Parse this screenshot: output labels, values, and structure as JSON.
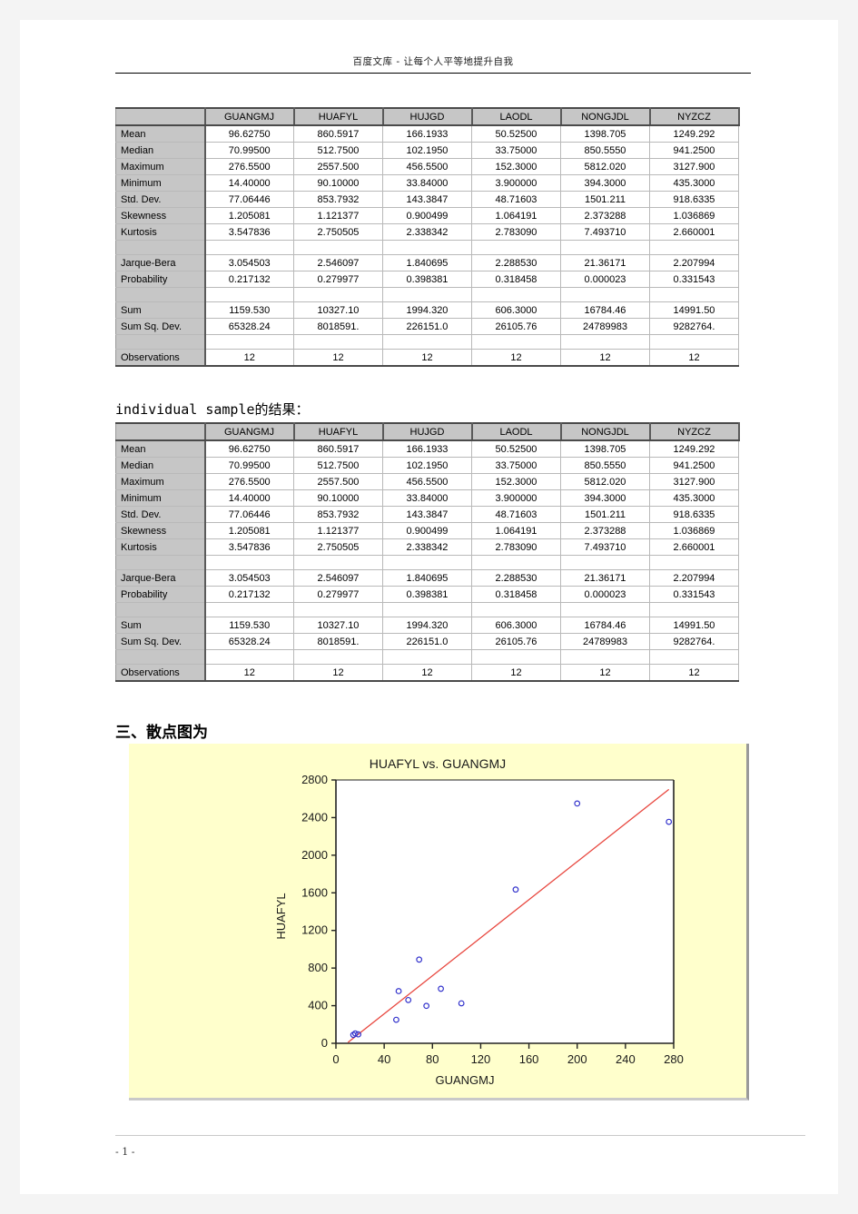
{
  "header": {
    "text": "百度文库 - 让每个人平等地提升自我"
  },
  "footer": {
    "page_number": "- 1 -"
  },
  "body": {
    "mid_note_mono": "individual sample",
    "mid_note_cn": "的结果：",
    "section_heading": "三、散点图为"
  },
  "table": {
    "corner_label": "",
    "columns": [
      "GUANGMJ",
      "HUAFYL",
      "HUJGD",
      "LAODL",
      "NONGJDL",
      "NYZCZ"
    ],
    "rows": [
      {
        "label": "Mean",
        "values": [
          "96.62750",
          "860.5917",
          "166.1933",
          "50.52500",
          "1398.705",
          "1249.292"
        ]
      },
      {
        "label": "Median",
        "values": [
          "70.99500",
          "512.7500",
          "102.1950",
          "33.75000",
          "850.5550",
          "941.2500"
        ]
      },
      {
        "label": "Maximum",
        "values": [
          "276.5500",
          "2557.500",
          "456.5500",
          "152.3000",
          "5812.020",
          "3127.900"
        ]
      },
      {
        "label": "Minimum",
        "values": [
          "14.40000",
          "90.10000",
          "33.84000",
          "3.900000",
          "394.3000",
          "435.3000"
        ]
      },
      {
        "label": "Std. Dev.",
        "values": [
          "77.06446",
          "853.7932",
          "143.3847",
          "48.71603",
          "1501.211",
          "918.6335"
        ]
      },
      {
        "label": "Skewness",
        "values": [
          "1.205081",
          "1.121377",
          "0.900499",
          "1.064191",
          "2.373288",
          "1.036869"
        ]
      },
      {
        "label": "Kurtosis",
        "values": [
          "3.547836",
          "2.750505",
          "2.338342",
          "2.783090",
          "7.493710",
          "2.660001"
        ]
      },
      {
        "label": "",
        "values": [
          "",
          "",
          "",
          "",
          "",
          ""
        ],
        "gap": true
      },
      {
        "label": "Jarque-Bera",
        "values": [
          "3.054503",
          "2.546097",
          "1.840695",
          "2.288530",
          "21.36171",
          "2.207994"
        ]
      },
      {
        "label": "Probability",
        "values": [
          "0.217132",
          "0.279977",
          "0.398381",
          "0.318458",
          "0.000023",
          "0.331543"
        ]
      },
      {
        "label": "",
        "values": [
          "",
          "",
          "",
          "",
          "",
          ""
        ],
        "gap": true
      },
      {
        "label": "Sum",
        "values": [
          "1159.530",
          "10327.10",
          "1994.320",
          "606.3000",
          "16784.46",
          "14991.50"
        ]
      },
      {
        "label": "Sum Sq. Dev.",
        "values": [
          "65328.24",
          "8018591.",
          "226151.0",
          "26105.76",
          "24789983",
          "9282764."
        ]
      },
      {
        "label": "",
        "values": [
          "",
          "",
          "",
          "",
          "",
          ""
        ],
        "gap": true
      },
      {
        "label": "Observations",
        "values": [
          "12",
          "12",
          "12",
          "12",
          "12",
          "12"
        ]
      }
    ]
  },
  "chart_data": {
    "type": "scatter",
    "title": "HUAFYL vs. GUANGMJ",
    "xlabel": "GUANGMJ",
    "ylabel": "HUAFYL",
    "xlim": [
      0,
      280
    ],
    "ylim": [
      0,
      2800
    ],
    "xticks": [
      0,
      40,
      80,
      120,
      160,
      200,
      240,
      280
    ],
    "yticks": [
      0,
      400,
      800,
      1200,
      1600,
      2000,
      2400,
      2800
    ],
    "grid": false,
    "legend": "none",
    "marker_color": "#3333cc",
    "fit_line_color": "#e8473f",
    "plot_background": "#ffffff",
    "panel_background": "#ffffcc",
    "points": [
      {
        "x": 14.4,
        "y": 90.1
      },
      {
        "x": 16.0,
        "y": 105.0
      },
      {
        "x": 18.5,
        "y": 95.0
      },
      {
        "x": 50.0,
        "y": 250.0
      },
      {
        "x": 52.0,
        "y": 555.0
      },
      {
        "x": 60.0,
        "y": 460.0
      },
      {
        "x": 69.0,
        "y": 890.0
      },
      {
        "x": 75.0,
        "y": 398.0
      },
      {
        "x": 87.0,
        "y": 580.0
      },
      {
        "x": 104.0,
        "y": 425.0
      },
      {
        "x": 149.0,
        "y": 1635.0
      },
      {
        "x": 200.0,
        "y": 2550.0
      },
      {
        "x": 276.0,
        "y": 2355.0
      }
    ],
    "fit_line": {
      "x0": 10,
      "y0": 10,
      "x1": 276,
      "y1": 2700
    }
  }
}
